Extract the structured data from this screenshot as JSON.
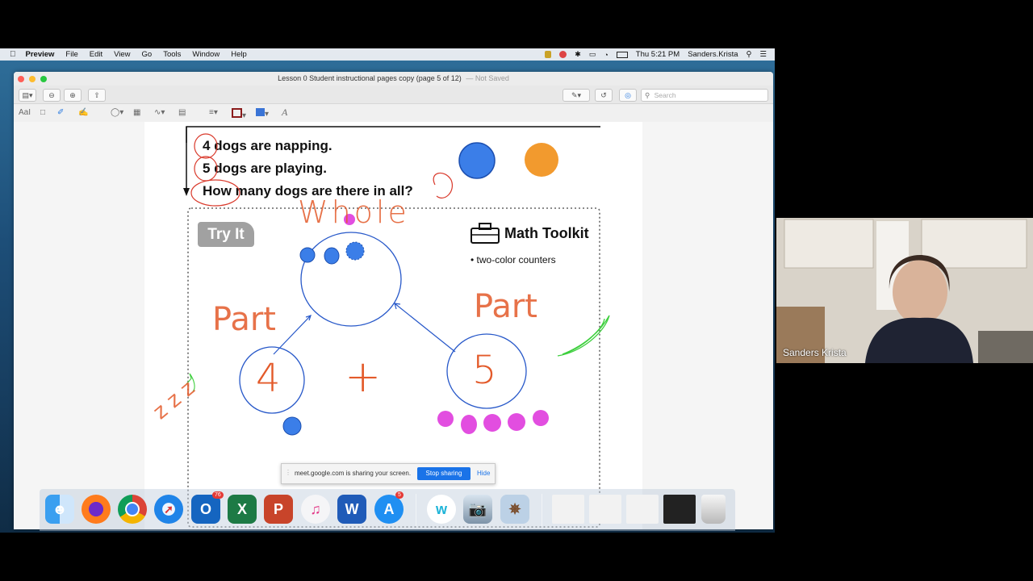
{
  "menubar": {
    "app": "Preview",
    "items": [
      "File",
      "Edit",
      "View",
      "Go",
      "Tools",
      "Window",
      "Help"
    ],
    "clock": "Thu 5:21 PM",
    "user": "Sanders.Krista"
  },
  "window": {
    "title": "Lesson 0 Student instructional pages copy (page 5 of 12)",
    "title_status": "— Not Saved",
    "search_placeholder": "Search"
  },
  "toolbar2": {
    "markup_text": "AaI",
    "text_tool": "A"
  },
  "document": {
    "lines": [
      {
        "num": "4",
        "text": "dogs are napping."
      },
      {
        "num": "5",
        "text": "dogs are playing."
      }
    ],
    "question": "How many dogs are there in all?",
    "try_it": "Try It",
    "toolkit_title": "Math Toolkit",
    "toolkit_item": "• two-color counters",
    "handwriting": {
      "whole": "Whole",
      "part_left": "Part",
      "part_right": "Part",
      "num_left": "4",
      "num_right": "5",
      "plus": "+",
      "zz": "z z z"
    }
  },
  "sharebar": {
    "message": "meet.google.com is sharing your screen.",
    "stop": "Stop sharing",
    "hide": "Hide"
  },
  "dock": {
    "outlook_badge": "76",
    "appstore_badge": "5",
    "apps": [
      "finder",
      "firefox",
      "chrome",
      "safari",
      "outlook",
      "excel",
      "powerpoint",
      "itunes",
      "word",
      "app-store",
      "webex",
      "preview",
      "migration"
    ]
  },
  "webcam": {
    "name": "Sanders Krista"
  },
  "colors": {
    "blue_counter": "#3b7ee8",
    "orange_counter": "#f29a2e",
    "magenta_counter": "#e24ee0",
    "ink_blue": "#2758c9",
    "ink_orange": "#e35a2a",
    "ink_green": "#3dcf3d"
  }
}
